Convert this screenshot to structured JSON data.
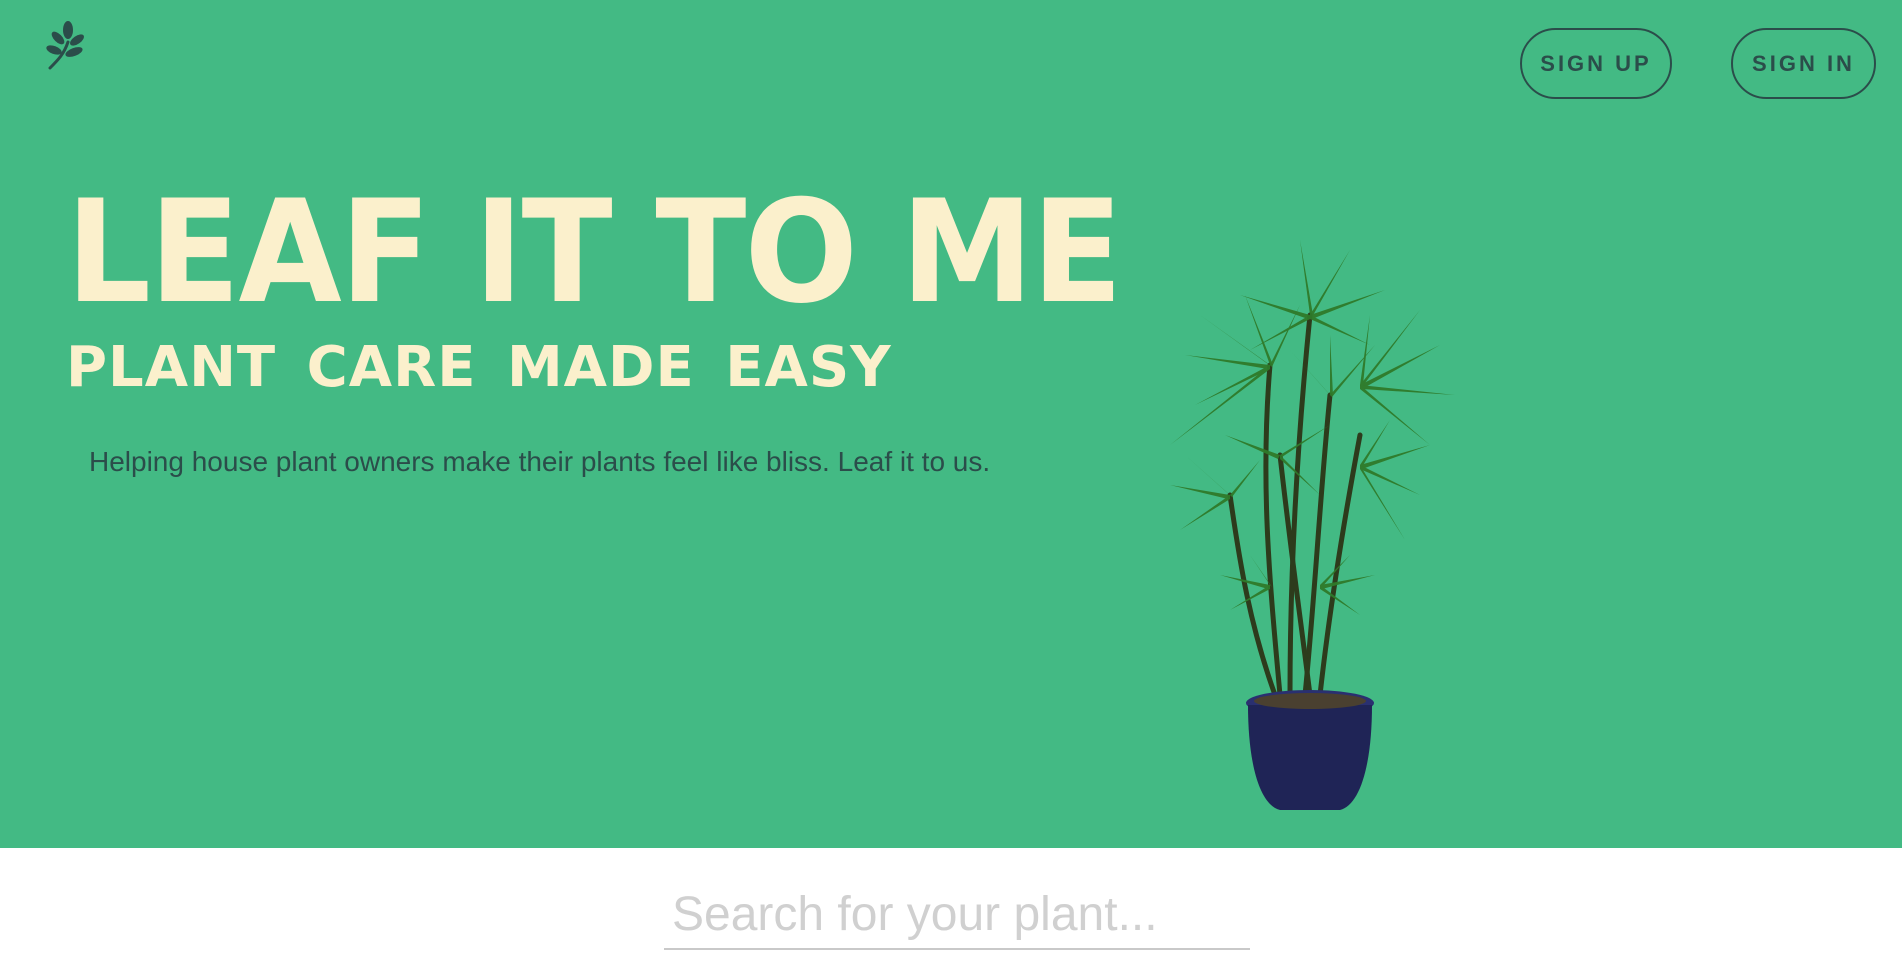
{
  "header": {
    "logo_icon": "leaf-sprig-icon",
    "sign_up_label": "SIGN UP",
    "sign_in_label": "SIGN IN"
  },
  "hero": {
    "title": "LEAF IT TO ME",
    "subtitle": "PLANT CARE MADE EASY",
    "description": "Helping house plant owners make their plants feel like bliss. Leaf it to us.",
    "image_icon": "potted-palm-plant"
  },
  "search": {
    "placeholder": "Search for your plant...",
    "value": ""
  },
  "colors": {
    "hero_background": "#43ba84",
    "headline_cream": "#fbf0cc",
    "dark_teal": "#2b4d4a",
    "pot_navy": "#1f2456"
  }
}
